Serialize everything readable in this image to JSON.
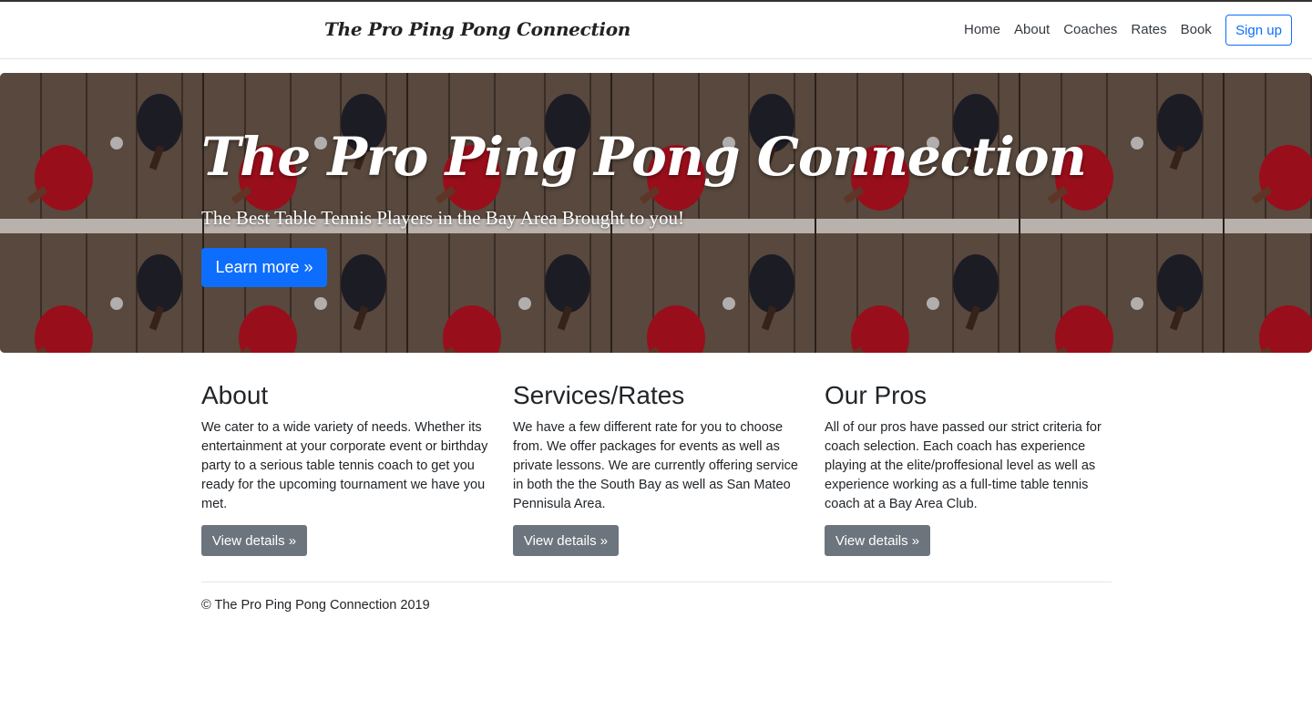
{
  "nav": {
    "brand": "The Pro Ping Pong Connection",
    "links": [
      "Home",
      "About",
      "Coaches",
      "Rates",
      "Book"
    ],
    "signup_label": "Sign up"
  },
  "hero": {
    "title": "The Pro Ping Pong Connection",
    "subtitle": "The Best Table Tennis Players in the Bay Area Brought to you!",
    "button_label": "Learn more »",
    "button_color": "#0d6efd"
  },
  "columns": [
    {
      "heading": "About",
      "text": "We cater to a wide variety of needs. Whether its entertainment at your corporate event or birthday party to a serious table tennis coach to get you ready for the upcoming tournament we have you met.",
      "button_label": "View details »"
    },
    {
      "heading": "Services/Rates",
      "text": "We have a few different rate for you to choose from. We offer packages for events as well as private lessons. We are currently offering service in both the the South Bay as well as San Mateo Pennisula Area.",
      "button_label": "View details »"
    },
    {
      "heading": "Our Pros",
      "text": "All of our pros have passed our strict criteria for coach selection. Each coach has experience playing at the elite/proffesional level as well as experience working as a full-time table tennis coach at a Bay Area Club.",
      "button_label": "View details »"
    }
  ],
  "footer": {
    "text": "© The Pro Ping Pong Connection 2019"
  }
}
